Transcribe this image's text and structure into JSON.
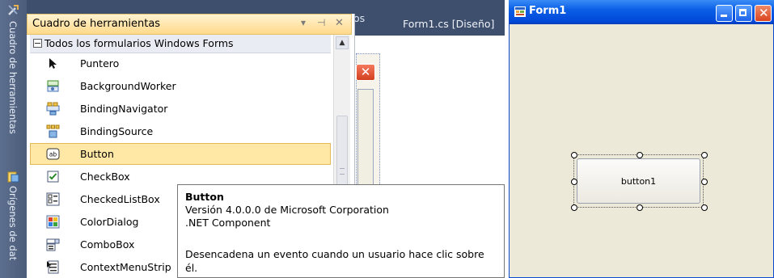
{
  "side_tabs": [
    {
      "label": "Cuadro de herramientas",
      "icon": "tools-icon"
    },
    {
      "label": "Orígenes de dat",
      "icon": "datasource-icon"
    }
  ],
  "toolbox": {
    "title": "Cuadro de herramientas",
    "controls": {
      "dropdown": "▾",
      "pin": "⊣",
      "close": "✕"
    },
    "group": "Todos los formularios Windows Forms",
    "selected": "Button",
    "items": [
      {
        "label": "Puntero",
        "icon": "pointer-icon"
      },
      {
        "label": "BackgroundWorker",
        "icon": "background-worker-icon"
      },
      {
        "label": "BindingNavigator",
        "icon": "binding-navigator-icon"
      },
      {
        "label": "BindingSource",
        "icon": "binding-source-icon"
      },
      {
        "label": "Button",
        "icon": "button-tool-icon"
      },
      {
        "label": "CheckBox",
        "icon": "checkbox-tool-icon"
      },
      {
        "label": "CheckedListBox",
        "icon": "checked-listbox-icon"
      },
      {
        "label": "ColorDialog",
        "icon": "color-dialog-icon"
      },
      {
        "label": "ComboBox",
        "icon": "combobox-tool-icon"
      },
      {
        "label": "ContextMenuStrip",
        "icon": "context-menu-strip-icon"
      }
    ]
  },
  "editor": {
    "tabs": [
      {
        "label": "os"
      },
      {
        "label": "Form1.cs [Diseño]"
      }
    ]
  },
  "tooltip": {
    "title": "Button",
    "lines": [
      "Versión 4.0.0.0 de Microsoft Corporation",
      ".NET Component",
      "",
      "Desencadena un evento cuando un usuario hace clic sobre",
      "él."
    ]
  },
  "form": {
    "title": "Form1",
    "button_label": "button1"
  },
  "colors": {
    "accent_selected": "#ffe8a6",
    "titlebar_blue": "#0a5ee6",
    "panel_dark": "#3e4f6e"
  }
}
